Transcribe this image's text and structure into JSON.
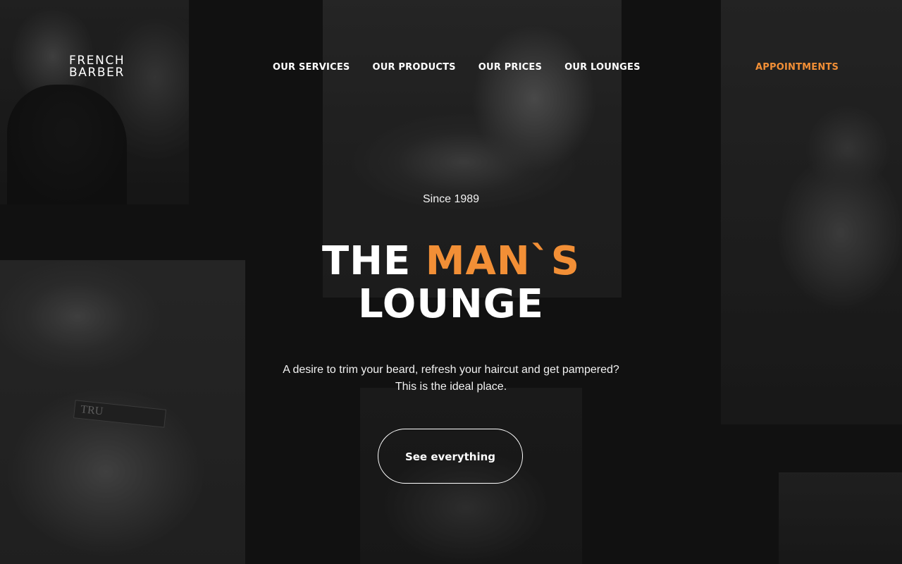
{
  "brand": {
    "line1": "FRENCH",
    "line2": "BARBER"
  },
  "nav": {
    "items": [
      {
        "label": "OUR SERVICES"
      },
      {
        "label": "OUR PRODUCTS"
      },
      {
        "label": "OUR PRICES"
      },
      {
        "label": "OUR LOUNGES"
      }
    ],
    "appointments_label": "APPOINTMENTS"
  },
  "hero": {
    "since": "Since 1989",
    "headline_white_1": "THE ",
    "headline_accent": "MAN`S",
    "headline_white_2": "LOUNGE",
    "description_line1": "A desire to trim your beard, refresh your haircut and get pampered?",
    "description_line2": "This is the ideal place.",
    "cta_label": "See everything"
  },
  "photo_text": {
    "razor_label": "TRU"
  },
  "colors": {
    "accent": "#f28f36",
    "background": "#141414",
    "text": "#ffffff"
  }
}
